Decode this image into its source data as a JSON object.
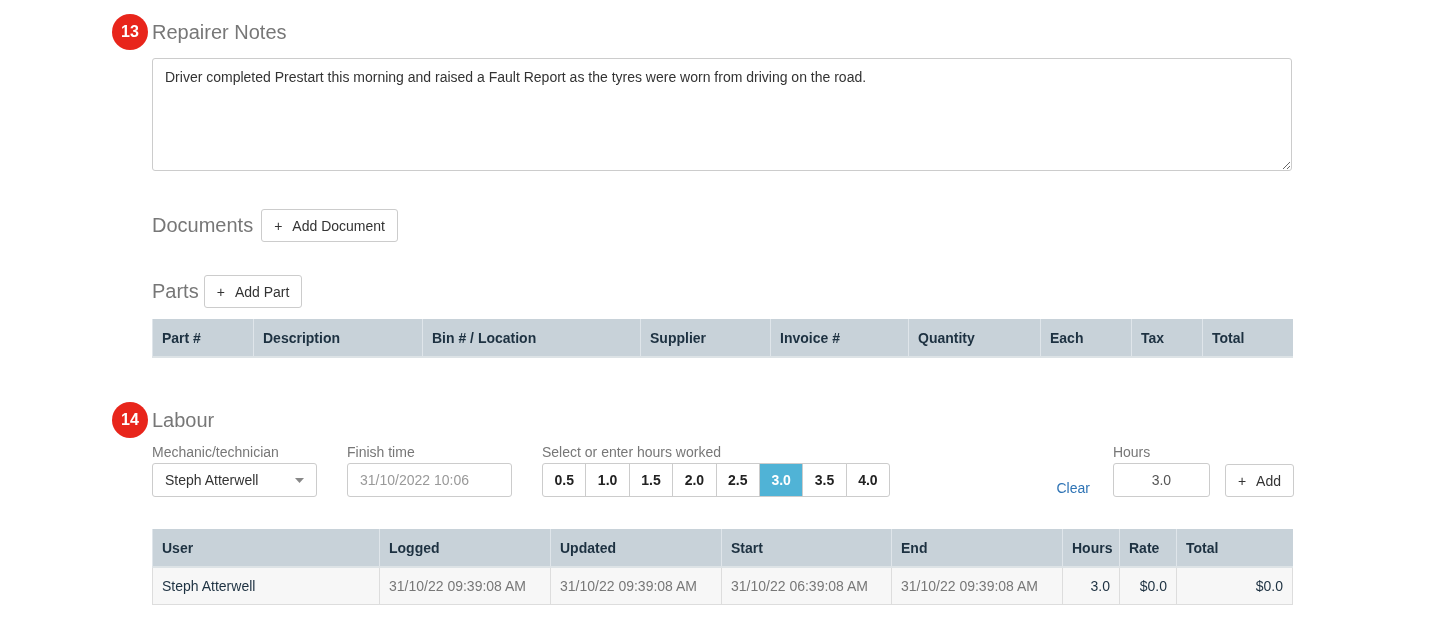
{
  "repairer_notes": {
    "number": "13",
    "title": "Repairer Notes",
    "value": "Driver completed Prestart this morning and raised a Fault Report as the tyres were worn from driving on the road."
  },
  "documents": {
    "title": "Documents",
    "button": "+",
    "button_label": "Add Document"
  },
  "parts": {
    "title": "Parts",
    "button": "+",
    "button_label": "Add Part",
    "columns": [
      "Part #",
      "Description",
      "Bin # / Location",
      "Supplier",
      "Invoice #",
      "Quantity",
      "Each",
      "Tax",
      "Total"
    ]
  },
  "labour": {
    "number": "14",
    "title": "Labour",
    "mechanic": {
      "label": "Mechanic/technician",
      "value": "Steph Atterwell"
    },
    "finish_time": {
      "label": "Finish time",
      "placeholder": "31/10/2022 10:06"
    },
    "hours_worked": {
      "label": "Select or enter hours worked",
      "options": [
        {
          "label": "0.5",
          "selected": false
        },
        {
          "label": "1.0",
          "selected": false
        },
        {
          "label": "1.5",
          "selected": false
        },
        {
          "label": "2.0",
          "selected": false
        },
        {
          "label": "2.5",
          "selected": false
        },
        {
          "label": "3.0",
          "selected": true
        },
        {
          "label": "3.5",
          "selected": false
        },
        {
          "label": "4.0",
          "selected": false
        }
      ]
    },
    "clear": "Clear",
    "hours": {
      "label": "Hours",
      "value": "3.0"
    },
    "add_button": "+",
    "add_label": "Add",
    "table": {
      "columns": [
        "User",
        "Logged",
        "Updated",
        "Start",
        "End",
        "Hours",
        "Rate",
        "Total"
      ],
      "rows": [
        [
          "Steph Atterwell",
          "31/10/22 09:39:08 AM",
          "31/10/22 09:39:08 AM",
          "31/10/22 06:39:08 AM",
          "31/10/22 09:39:08 AM",
          "3.0",
          "$0.0",
          "$0.0"
        ]
      ]
    }
  }
}
